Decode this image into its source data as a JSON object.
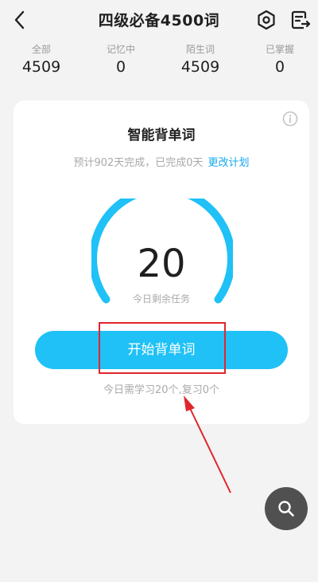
{
  "header": {
    "title": "四级必备4500词",
    "icons": [
      "back-icon",
      "settings-icon",
      "word-list-icon"
    ]
  },
  "stats": [
    {
      "label": "全部",
      "value": "4509"
    },
    {
      "label": "记忆中",
      "value": "0"
    },
    {
      "label": "陌生词",
      "value": "4509"
    },
    {
      "label": "已掌握",
      "value": "0"
    }
  ],
  "card": {
    "title": "智能背单词",
    "plan_text": "预计902天完成，已完成0天",
    "change_plan_link": "更改计划",
    "remaining_count": "20",
    "remaining_caption": "今日剩余任务",
    "start_button": "开始背单词",
    "today_note": "今日需学习20个,复习0个"
  },
  "colors": {
    "accent": "#1fc1f6",
    "link": "#14a9f0",
    "annotation": "#e0262c",
    "fab": "#505050"
  }
}
